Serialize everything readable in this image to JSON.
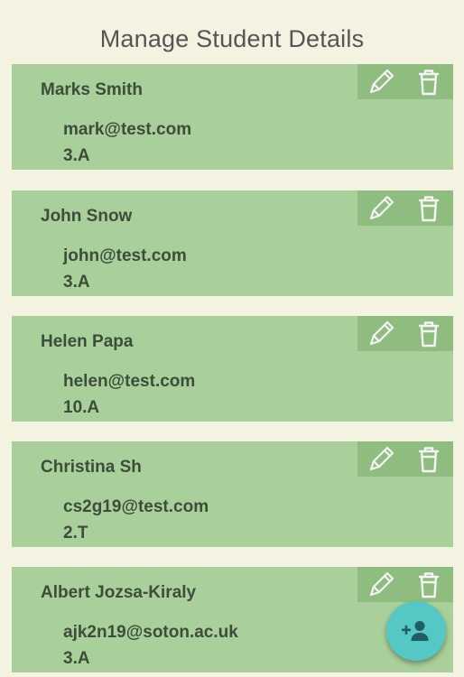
{
  "header": {
    "title": "Manage Student Details"
  },
  "students": [
    {
      "name": "Marks Smith",
      "email": "mark@test.com",
      "class": "3.A"
    },
    {
      "name": "John Snow",
      "email": "john@test.com",
      "class": "3.A"
    },
    {
      "name": "Helen Papa",
      "email": "helen@test.com",
      "class": "10.A"
    },
    {
      "name": "Christina Sh",
      "email": "cs2g19@test.com",
      "class": "2.T"
    },
    {
      "name": "Albert Jozsa-Kiraly",
      "email": "ajk2n19@soton.ac.uk",
      "class": "3.A"
    }
  ],
  "icons": {
    "edit": "pencil-icon",
    "delete": "trash-icon",
    "add": "add-person-icon"
  },
  "colors": {
    "background": "#f4f2e0",
    "card": "#a9d09a",
    "card_actions": "#8fbd7f",
    "fab": "#55c7c4"
  }
}
